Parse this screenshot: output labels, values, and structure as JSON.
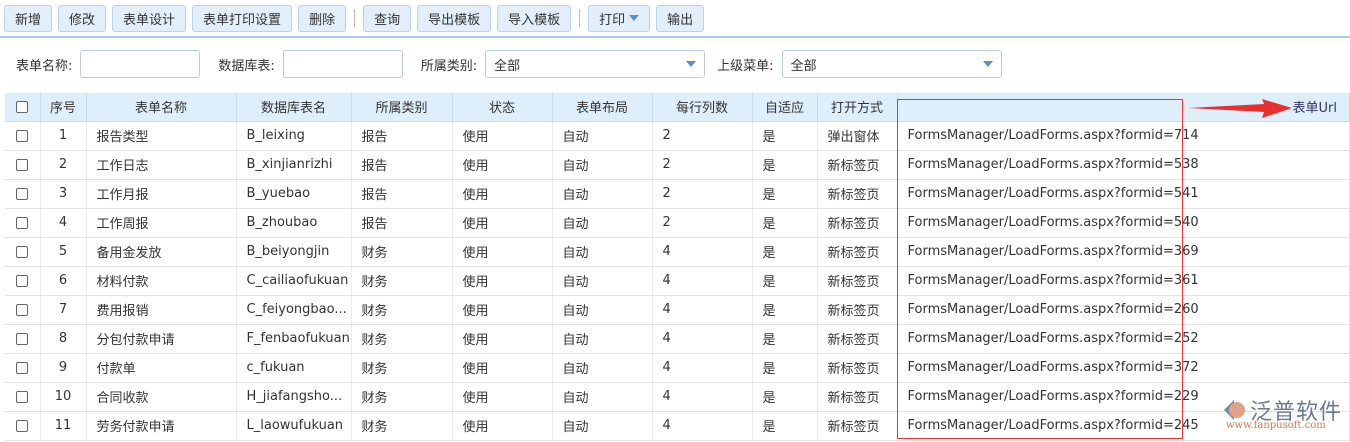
{
  "toolbar": {
    "buttons": [
      "新增",
      "修改",
      "表单设计",
      "表单打印设置",
      "删除",
      "查询",
      "导出模板",
      "导入模板",
      "打印",
      "输出"
    ]
  },
  "filters": {
    "form_name_label": "表单名称:",
    "db_table_label": "数据库表:",
    "category_label": "所属类别:",
    "category_value": "全部",
    "parent_menu_label": "上级菜单:",
    "parent_menu_value": "全部"
  },
  "table": {
    "headers": [
      "序号",
      "表单名称",
      "数据库表名",
      "所属类别",
      "状态",
      "表单布局",
      "每行列数",
      "自适应",
      "打开方式",
      "表单Url"
    ],
    "rows": [
      [
        "1",
        "报告类型",
        "B_leixing",
        "报告",
        "使用",
        "自动",
        "2",
        "是",
        "弹出窗体",
        "FormsManager/LoadForms.aspx?formid=714"
      ],
      [
        "2",
        "工作日志",
        "B_xinjianrizhi",
        "报告",
        "使用",
        "自动",
        "2",
        "是",
        "新标签页",
        "FormsManager/LoadForms.aspx?formid=538"
      ],
      [
        "3",
        "工作月报",
        "B_yuebao",
        "报告",
        "使用",
        "自动",
        "2",
        "是",
        "新标签页",
        "FormsManager/LoadForms.aspx?formid=541"
      ],
      [
        "4",
        "工作周报",
        "B_zhoubao",
        "报告",
        "使用",
        "自动",
        "2",
        "是",
        "新标签页",
        "FormsManager/LoadForms.aspx?formid=540"
      ],
      [
        "5",
        "备用金发放",
        "B_beiyongjin",
        "财务",
        "使用",
        "自动",
        "4",
        "是",
        "新标签页",
        "FormsManager/LoadForms.aspx?formid=369"
      ],
      [
        "6",
        "材料付款",
        "C_cailiaofukuan",
        "财务",
        "使用",
        "自动",
        "4",
        "是",
        "新标签页",
        "FormsManager/LoadForms.aspx?formid=361"
      ],
      [
        "7",
        "费用报销",
        "C_feiyongbao...",
        "财务",
        "使用",
        "自动",
        "4",
        "是",
        "新标签页",
        "FormsManager/LoadForms.aspx?formid=260"
      ],
      [
        "8",
        "分包付款申请",
        "F_fenbaofukuan",
        "财务",
        "使用",
        "自动",
        "4",
        "是",
        "新标签页",
        "FormsManager/LoadForms.aspx?formid=252"
      ],
      [
        "9",
        "付款单",
        "c_fukuan",
        "财务",
        "使用",
        "自动",
        "4",
        "是",
        "新标签页",
        "FormsManager/LoadForms.aspx?formid=372"
      ],
      [
        "10",
        "合同收款",
        "H_jiafangsho...",
        "财务",
        "使用",
        "自动",
        "4",
        "是",
        "新标签页",
        "FormsManager/LoadForms.aspx?formid=229"
      ],
      [
        "11",
        "劳务付款申请",
        "L_laowufukuan",
        "财务",
        "使用",
        "自动",
        "4",
        "是",
        "新标签页",
        "FormsManager/LoadForms.aspx?formid=245"
      ]
    ]
  },
  "logo": {
    "name": "泛普软件",
    "url": "www.fanpusoft.com"
  }
}
